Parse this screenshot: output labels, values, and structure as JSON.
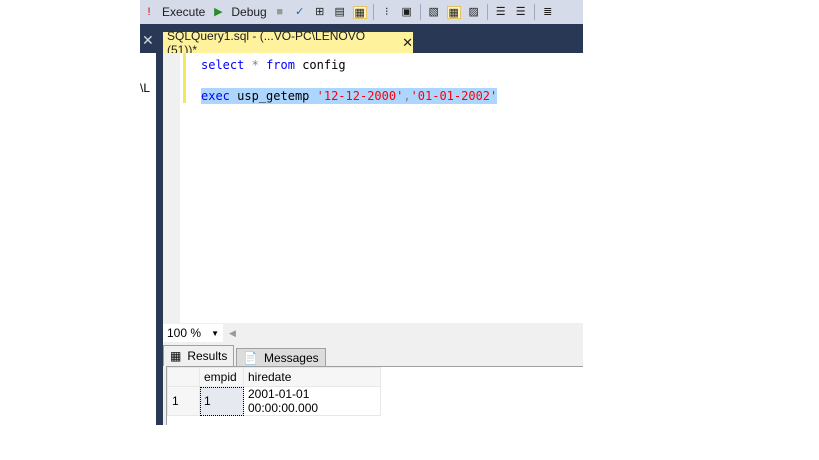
{
  "toolbar": {
    "execute_label": "Execute",
    "debug_label": "Debug"
  },
  "left_panel": {
    "text": "\\L"
  },
  "tab": {
    "title": "SQLQuery1.sql - (...VO-PC\\LENOVO (51))*"
  },
  "editor": {
    "line1": {
      "kw1": "select",
      "op": "*",
      "kw2": "from",
      "ident": "config"
    },
    "line3": {
      "kw": "exec",
      "ident": "usp_getemp",
      "arg1": "'12-12-2000'",
      "comma": ",",
      "arg2": "'01-01-2002'"
    }
  },
  "zoom": {
    "value": "100 %"
  },
  "results_tabs": [
    {
      "label": "Results",
      "active": true
    },
    {
      "label": "Messages",
      "active": false
    }
  ],
  "grid": {
    "columns": [
      "empid",
      "hiredate"
    ],
    "rows": [
      {
        "num": "1",
        "empid": "1",
        "hiredate": "2001-01-01 00:00:00.000"
      }
    ]
  },
  "colors": {
    "chrome": "#293955",
    "active_tab": "#fff29d",
    "selection": "#add6ff"
  }
}
